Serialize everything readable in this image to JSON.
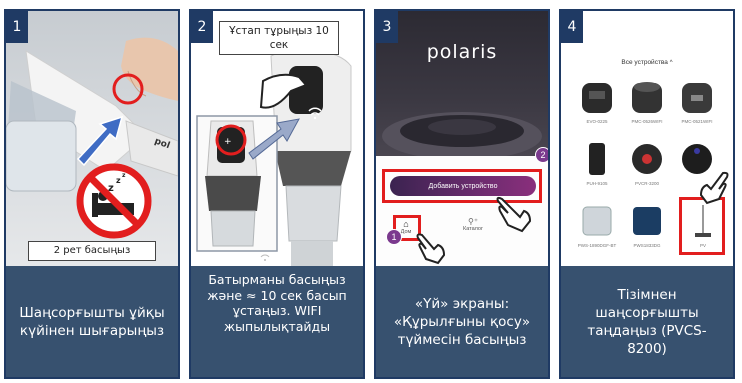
{
  "steps": [
    {
      "number": "1",
      "note": "2 рет басыңыз",
      "caption": "Шаңсорғышты ұйқы күйінен шығарыңыз"
    },
    {
      "number": "2",
      "note": "Ұстап тұрыңыз 10 сек",
      "caption": "Батырманы басыңыз және ≈ 10 сек басып ұстаңыз. WIFI жыпылықтайды"
    },
    {
      "number": "3",
      "caption": "«Үй» экраны: «Құрылғыны қосу» түймесін басыңыз",
      "app": {
        "logo": "polaris",
        "add_device_button": "Добавить устройство",
        "nav_home": "Дом",
        "nav_catalog": "Каталог",
        "badge_1": "1",
        "badge_2": "2"
      }
    },
    {
      "number": "4",
      "caption": "Тізімнен шаңсорғышты таңдаңыз (PVCS-8200)",
      "app": {
        "title": "Все устройства",
        "devices": [
          "EVO-0225",
          "PMC-0526WIFI",
          "PMC-0521WIFI",
          "PUH-9105",
          "PVCR-3200",
          "",
          "PWS-1890DGF-BT",
          "PWS1833DG",
          "PV"
        ]
      }
    }
  ],
  "colors": {
    "frame": "#1f3a64",
    "caption_bg": "#37516f",
    "highlight": "#e21e1e"
  }
}
